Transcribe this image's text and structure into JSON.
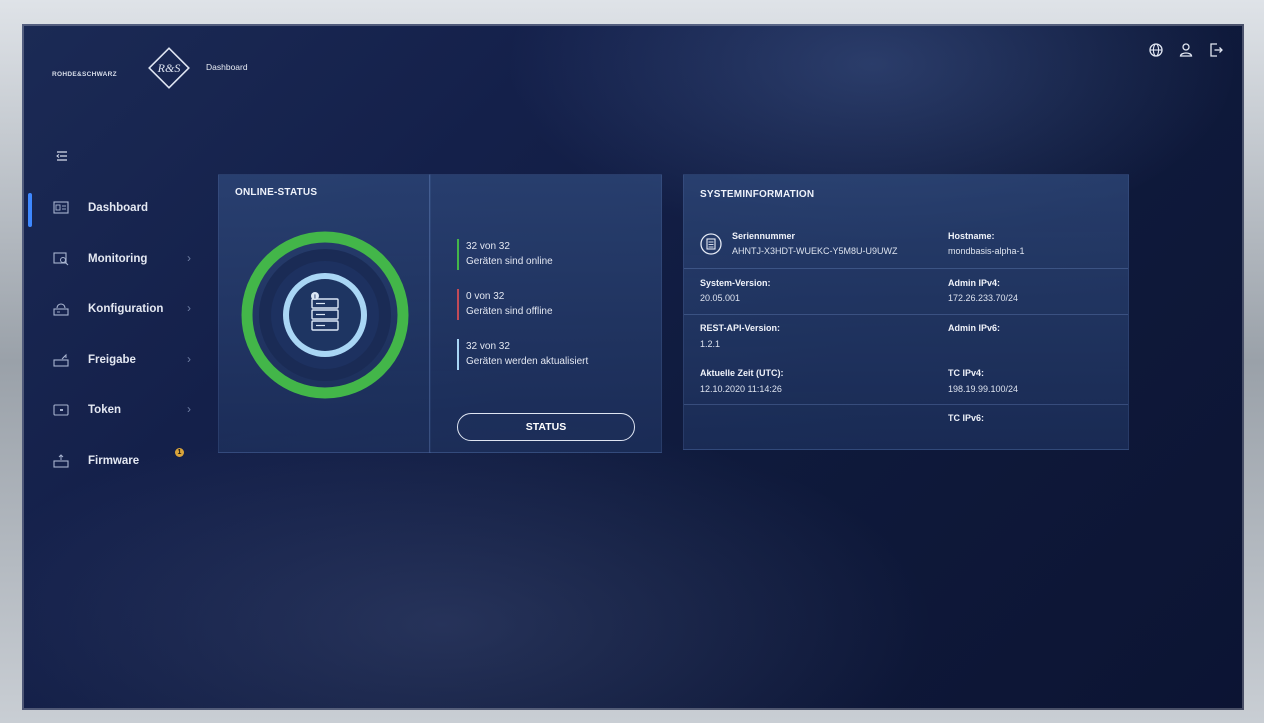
{
  "header": {
    "brand": "ROHDE&SCHWARZ",
    "logo_text": "R&S",
    "breadcrumb": "Dashboard",
    "icons": [
      "globe-icon",
      "user-icon",
      "logout-icon"
    ]
  },
  "sidebar": {
    "items": [
      {
        "label": "Dashboard",
        "icon": "dashboard-icon",
        "active": true
      },
      {
        "label": "Monitoring",
        "icon": "monitoring-icon",
        "chevron": "›"
      },
      {
        "label": "Konfiguration",
        "icon": "router-icon",
        "chevron": "›"
      },
      {
        "label": "Freigabe",
        "icon": "share-icon",
        "chevron": "›"
      },
      {
        "label": "Token",
        "icon": "token-icon",
        "chevron": "›"
      },
      {
        "label": "Firmware",
        "icon": "firmware-icon",
        "badge": "1"
      }
    ]
  },
  "online_status": {
    "title": "ONLINE-STATUS",
    "stats": [
      {
        "count": "32 von 32",
        "text": "Geräten sind online",
        "color": "#43b649"
      },
      {
        "count": "0 von 32",
        "text": "Geräten sind offline",
        "color": "#c24a57"
      },
      {
        "count": "32 von 32",
        "text": "Geräten werden aktualisiert",
        "color": "#a9d6f5"
      }
    ],
    "button": "STATUS",
    "online_fraction": 1.0
  },
  "system_info": {
    "title": "SYSTEMINFORMATION",
    "serial_label": "Seriennummer",
    "serial_value": "AHNTJ-X3HDT-WUEKC-Y5M8U-U9UWZ",
    "hostname_label": "Hostname:",
    "hostname_value": "mondbasis-alpha-1",
    "system_version_label": "System-Version:",
    "system_version_value": "20.05.001",
    "admin_ipv4_label": "Admin IPv4:",
    "admin_ipv4_value": "172.26.233.70/24",
    "rest_api_label": "REST-API-Version:",
    "rest_api_value": "1.2.1",
    "admin_ipv6_label": "Admin IPv6:",
    "time_label": "Aktuelle Zeit (UTC):",
    "time_value": "12.10.2020 11:14:26",
    "tc_ipv4_label": "TC IPv4:",
    "tc_ipv4_value": "198.19.99.100/24",
    "tc_ipv6_label": "TC IPv6:"
  },
  "colors": {
    "accent": "#3e88ff",
    "online": "#43b649",
    "offline": "#c24a57",
    "updating": "#a9d6f5",
    "badge": "#d9a43a"
  }
}
